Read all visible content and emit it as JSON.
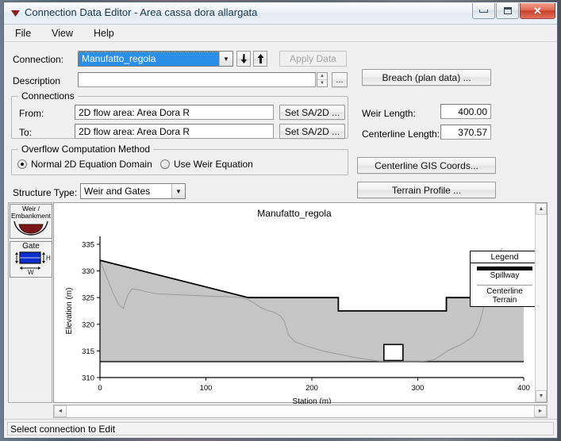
{
  "window": {
    "title": "Connection Data Editor - Area cassa dora allargata",
    "icon": "app-icon",
    "minimize_label": "",
    "maximize_label": "",
    "close_label": "✕"
  },
  "menu": {
    "items": [
      "File",
      "View",
      "Help"
    ]
  },
  "form": {
    "connection_label": "Connection:",
    "connection_value": "Manufatto_regola",
    "prev_arrow": "▼",
    "next_arrow": "▲",
    "apply_label": "Apply Data",
    "description_label": "Description",
    "description_value": "",
    "browse_label": "...",
    "breach_label": "Breach (plan data) ...",
    "weir_length_label": "Weir Length:",
    "weir_length_value": "400.00",
    "centerline_length_label": "Centerline Length:",
    "centerline_length_value": "370.57",
    "centerline_gis_label": "Centerline GIS Coords...",
    "terrain_profile_label": "Terrain Profile ...",
    "structure_type_label": "Structure Type:",
    "structure_type_value": "Weir and Gates"
  },
  "connections_group": {
    "title": "Connections",
    "from_label": "From:",
    "from_value": "2D flow area: Area Dora R",
    "from_button": "Set SA/2D ...",
    "to_label": "To:",
    "to_value": "2D flow area: Area Dora R",
    "to_button": "Set SA/2D ..."
  },
  "overflow_group": {
    "title": "Overflow Computation Method",
    "options": [
      {
        "label": "Normal 2D Equation Domain",
        "selected": true
      },
      {
        "label": "Use Weir Equation",
        "selected": false
      }
    ]
  },
  "palette": {
    "tools": [
      {
        "name": "weir-embankment",
        "line1": "Weir /",
        "line2": "Embankment",
        "color": "#7b1616"
      },
      {
        "name": "gate",
        "line1": "Gate",
        "line2": "",
        "color": "#0d2ecc",
        "h_label": "H",
        "w_label": "W"
      }
    ]
  },
  "statusbar": {
    "text": "Select connection to Edit"
  },
  "chart_data": {
    "type": "area",
    "title": "Manufatto_regola",
    "xlabel": "Station (m)",
    "ylabel": "Elevation (m)",
    "xlim": [
      0,
      400
    ],
    "ylim": [
      310,
      335
    ],
    "xticks": [
      0,
      100,
      200,
      300,
      400
    ],
    "yticks": [
      310,
      315,
      320,
      325,
      330,
      335
    ],
    "grid": false,
    "legend_title": "Legend",
    "legend": [
      {
        "name": "Spillway",
        "style": "thick-black-line",
        "color": "#000000"
      },
      {
        "name": "Centerline Terrain",
        "style": "thin-gray-line",
        "color": "#9a9a9a"
      }
    ],
    "series": [
      {
        "name": "Spillway",
        "color": "#000000",
        "x": [
          0,
          140,
          225,
          225,
          327,
          327,
          400
        ],
        "y": [
          332.0,
          325.0,
          325.0,
          322.5,
          322.5,
          325.0,
          325.0
        ]
      },
      {
        "name": "Centerline Terrain",
        "color": "#9a9a9a",
        "x": [
          0,
          6,
          12,
          18,
          22,
          26,
          30,
          36,
          44,
          54,
          66,
          78,
          90,
          100,
          110,
          118,
          126,
          134,
          140,
          146,
          152,
          158,
          164,
          170,
          174,
          178,
          184,
          190,
          196,
          202,
          210,
          220,
          230,
          240,
          252,
          264,
          276,
          288,
          300,
          308,
          316,
          322,
          328,
          334,
          340,
          346,
          352,
          358,
          362,
          366,
          370,
          374,
          380
        ],
        "y": [
          332.0,
          329.0,
          326.0,
          323.6,
          323.0,
          325.4,
          326.6,
          326.5,
          326.1,
          325.7,
          325.6,
          325.5,
          325.4,
          325.3,
          325.2,
          325.2,
          325.1,
          325.0,
          324.6,
          323.9,
          323.1,
          322.6,
          322.3,
          321.6,
          320.6,
          318.0,
          316.7,
          316.3,
          315.8,
          315.5,
          315.0,
          314.6,
          314.2,
          313.8,
          313.4,
          313.1,
          313.0,
          313.0,
          313.0,
          313.1,
          313.4,
          314.2,
          315.0,
          315.6,
          316.1,
          316.9,
          317.6,
          320.0,
          323.0,
          326.5,
          330.5,
          333.0,
          334.3
        ]
      }
    ],
    "fill": {
      "between": "Spillway and baseline",
      "color": "#c6c6c6",
      "baseline": 313.0
    },
    "baseline_value": 313.0,
    "gate": {
      "x_start": 268,
      "x_end": 286,
      "y_bottom": 313.2,
      "y_top": 316.2,
      "fill": "#ffffff"
    }
  }
}
